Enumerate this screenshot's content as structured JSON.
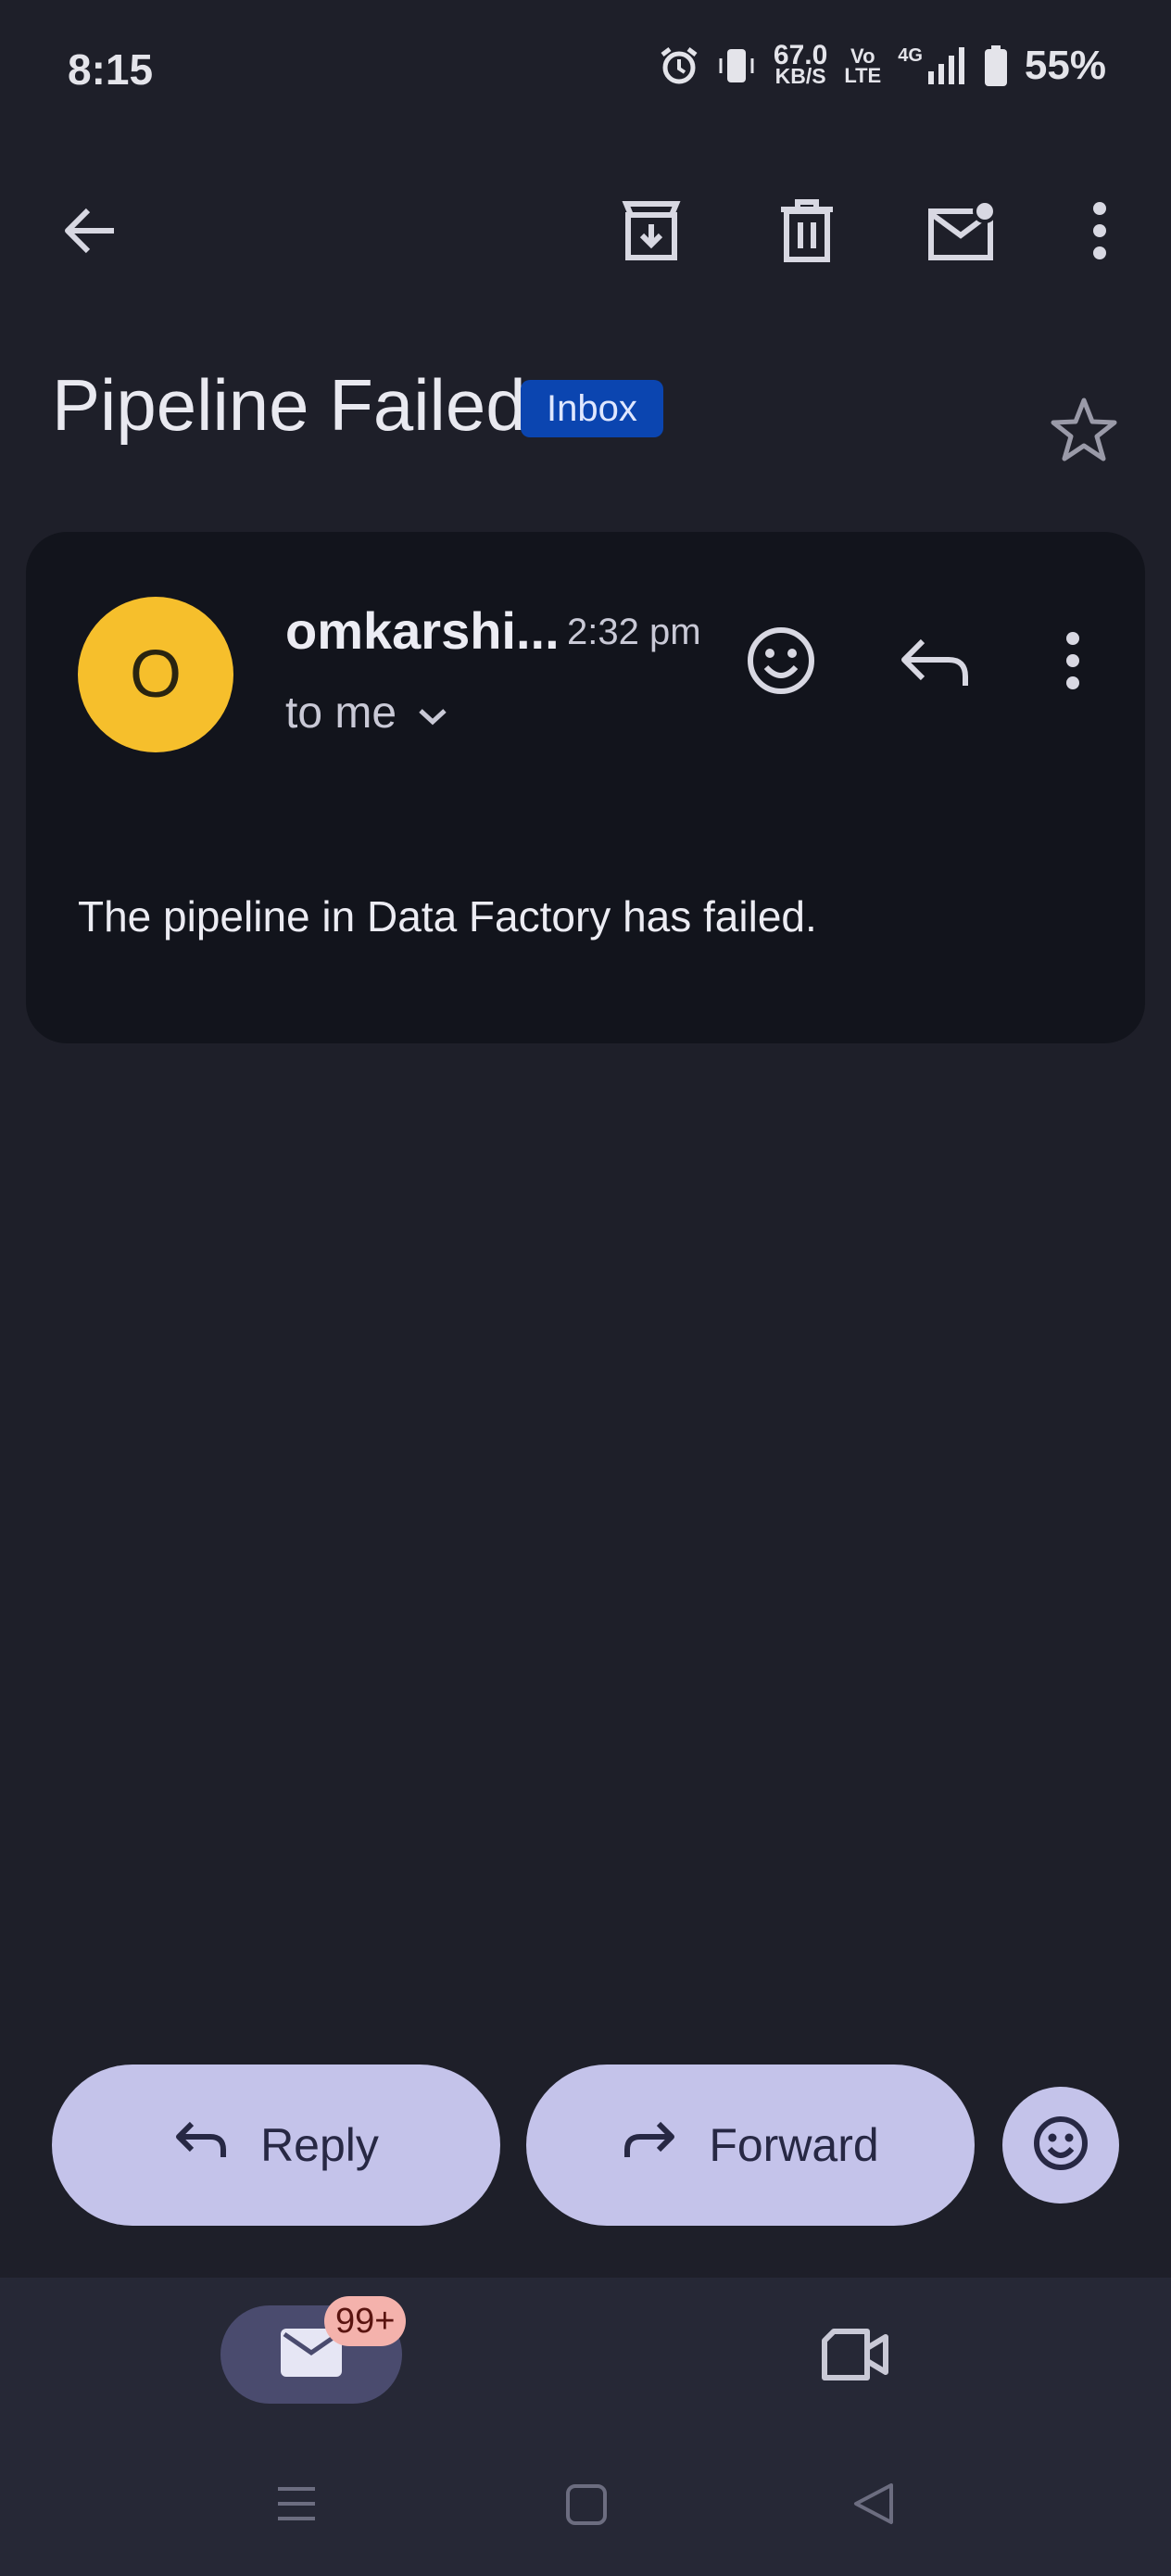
{
  "status_bar": {
    "time": "8:15",
    "speed_value": "67.0",
    "speed_unit": "KB/S",
    "volte_top": "Vo",
    "volte_bottom": "LTE",
    "network": "4G",
    "battery": "55%"
  },
  "toolbar": {
    "back_icon": "arrow-left-icon",
    "archive_icon": "archive-icon",
    "delete_icon": "trash-icon",
    "mark_unread_icon": "mail-unread-icon",
    "more_icon": "more-vert-icon"
  },
  "email": {
    "subject": "Pipeline Failed",
    "label": "Inbox",
    "starred": false,
    "sender_initial": "O",
    "sender": "omkarshi...",
    "time": "2:32 pm",
    "recipient": "to me",
    "body": "The pipeline in Data Factory has failed."
  },
  "actions": {
    "reply_label": "Reply",
    "forward_label": "Forward"
  },
  "bottom_nav": {
    "mail_badge": "99+"
  },
  "colors": {
    "background": "#1e1f29",
    "card": "#12141c",
    "accent_button": "#c4c3ea",
    "avatar": "#f6bf2c",
    "label_chip": "#0b45b0",
    "badge": "#f4b2ac"
  }
}
